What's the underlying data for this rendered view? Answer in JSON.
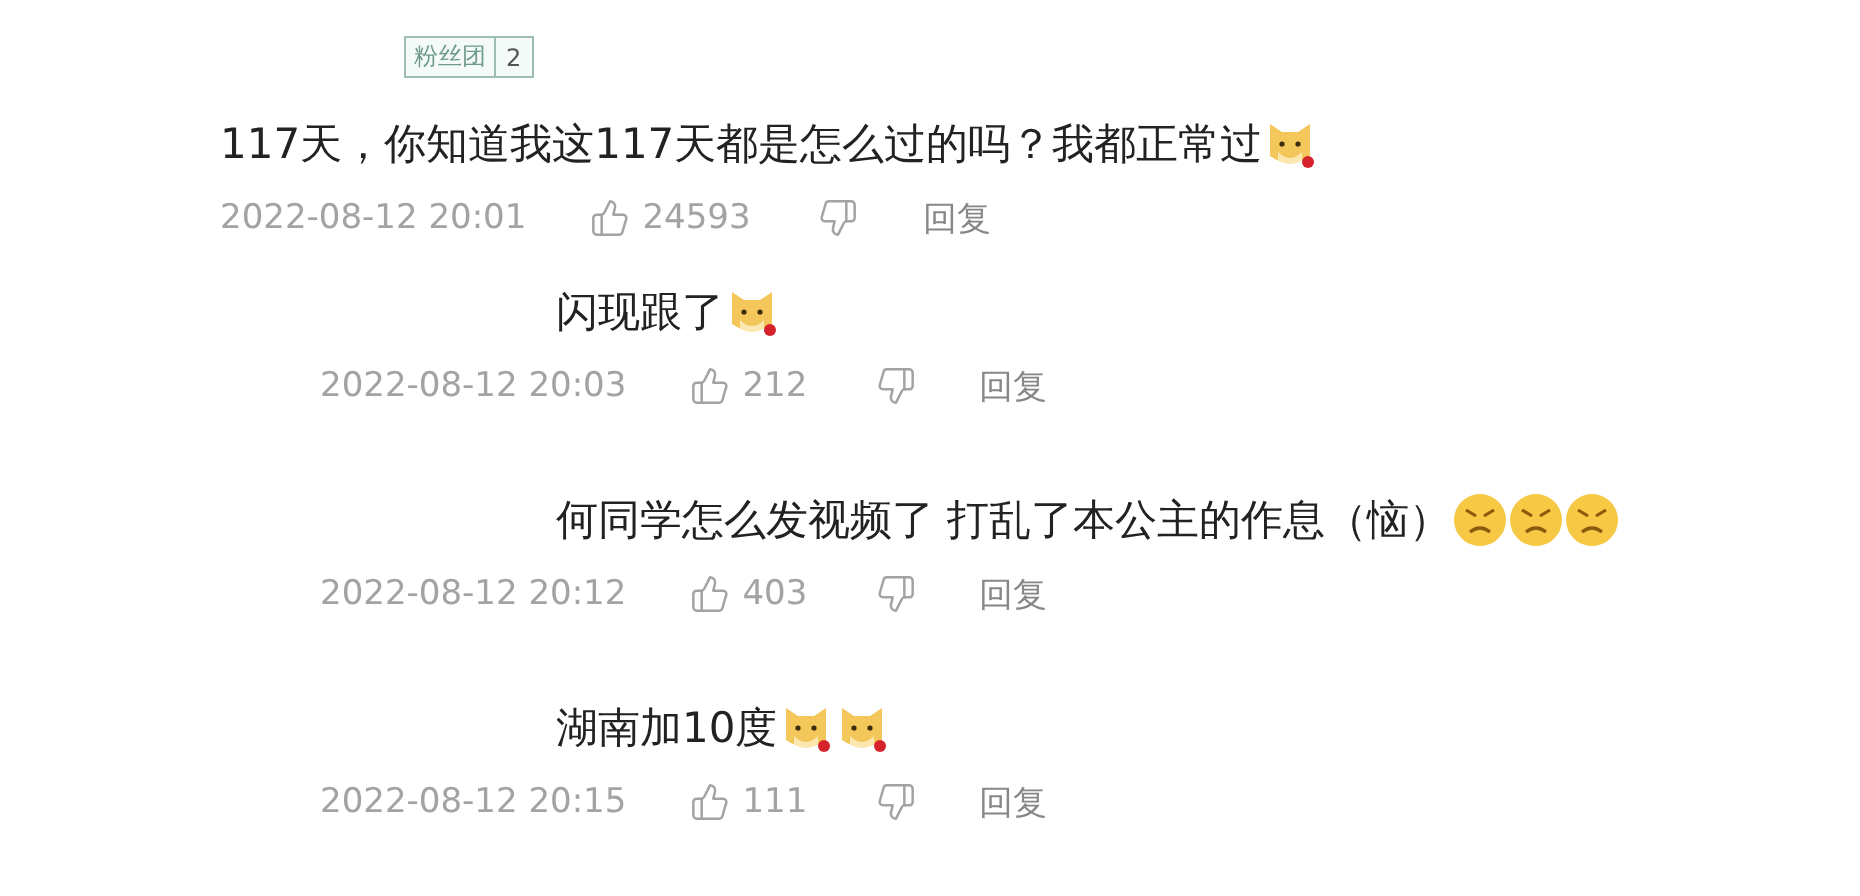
{
  "badge": {
    "label": "粉丝团",
    "level": "2"
  },
  "comment": {
    "text": "117天，你知道我这117天都是怎么过的吗？我都正常过",
    "emojis": [
      {
        "kind": "dog"
      }
    ],
    "time": "2022-08-12 20:01",
    "likes": "24593",
    "reply_label": "回复"
  },
  "replies": [
    {
      "text": "闪现跟了",
      "emojis": [
        {
          "kind": "dog"
        }
      ],
      "time": "2022-08-12 20:03",
      "likes": "212",
      "reply_label": "回复"
    },
    {
      "text": "何同学怎么发视频了  打乱了本公主的作息（恼）",
      "emojis": [
        {
          "kind": "angry"
        },
        {
          "kind": "angry"
        },
        {
          "kind": "angry"
        }
      ],
      "time": "2022-08-12 20:12",
      "likes": "403",
      "reply_label": "回复"
    },
    {
      "text": "湖南加10度",
      "emojis": [
        {
          "kind": "dog"
        },
        {
          "kind": "dog"
        }
      ],
      "time": "2022-08-12 20:15",
      "likes": "111",
      "reply_label": "回复"
    }
  ]
}
